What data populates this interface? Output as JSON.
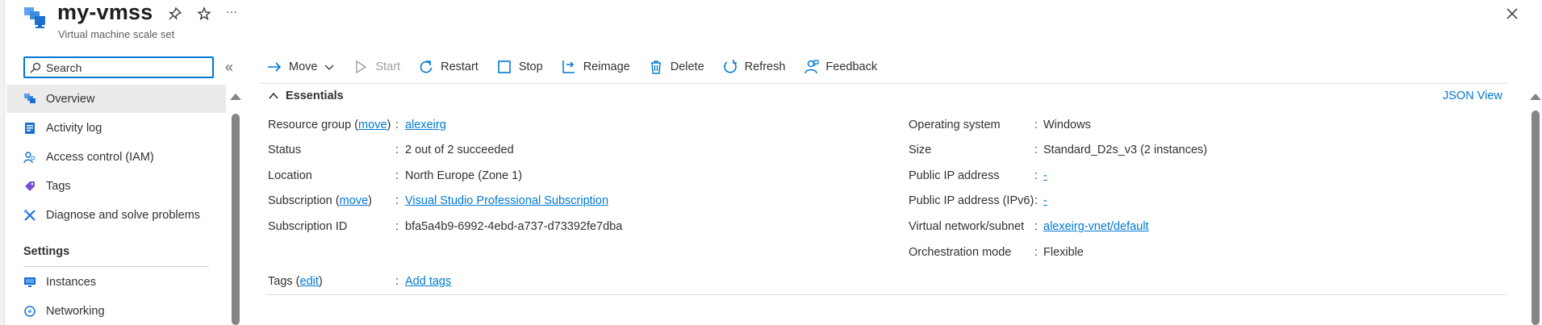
{
  "header": {
    "title": "my-vmss",
    "subtitle": "Virtual machine scale set",
    "more_label": "···"
  },
  "search": {
    "placeholder": "Search"
  },
  "nav": {
    "collapse_label": "«",
    "items": [
      {
        "label": "Overview",
        "icon": "vmss-icon",
        "selected": true
      },
      {
        "label": "Activity log",
        "icon": "activity-log-icon"
      },
      {
        "label": "Access control (IAM)",
        "icon": "iam-icon"
      },
      {
        "label": "Tags",
        "icon": "tag-icon"
      },
      {
        "label": "Diagnose and solve problems",
        "icon": "wrench-icon"
      }
    ],
    "section_settings": "Settings",
    "settings_items": [
      {
        "label": "Instances",
        "icon": "instances-icon"
      },
      {
        "label": "Networking",
        "icon": "networking-icon"
      }
    ]
  },
  "toolbar": {
    "move": "Move",
    "start": "Start",
    "restart": "Restart",
    "stop": "Stop",
    "reimage": "Reimage",
    "delete": "Delete",
    "refresh": "Refresh",
    "feedback": "Feedback"
  },
  "essentials": {
    "title": "Essentials",
    "json_view": "JSON View",
    "left": {
      "resource_group": {
        "label": "Resource group",
        "link": "move",
        "value": "alexeirg"
      },
      "status": {
        "label": "Status",
        "value": "2 out of 2 succeeded"
      },
      "location": {
        "label": "Location",
        "value": "North Europe (Zone 1)"
      },
      "subscription": {
        "label": "Subscription",
        "link": "move",
        "value": "Visual Studio Professional Subscription"
      },
      "subscription_id": {
        "label": "Subscription ID",
        "value": "bfa5a4b9-6992-4ebd-a737-d73392fe7dba"
      }
    },
    "right": {
      "os": {
        "label": "Operating system",
        "value": "Windows"
      },
      "size": {
        "label": "Size",
        "value": "Standard_D2s_v3 (2 instances)"
      },
      "public_ip": {
        "label": "Public IP address",
        "value": "-"
      },
      "public_ip6": {
        "label": "Public IP address (IPv6)",
        "value": "-"
      },
      "vnet": {
        "label": "Virtual network/subnet",
        "value": "alexeirg-vnet/default"
      },
      "orchestration": {
        "label": "Orchestration mode",
        "value": "Flexible"
      }
    },
    "tags": {
      "label": "Tags",
      "link": "edit",
      "value": "Add tags"
    },
    "separator": ":",
    "paren_open": "(",
    "paren_close": ")"
  },
  "colors": {
    "accent": "#0078d4",
    "text": "#323130",
    "selected_bg": "#edebe9"
  }
}
